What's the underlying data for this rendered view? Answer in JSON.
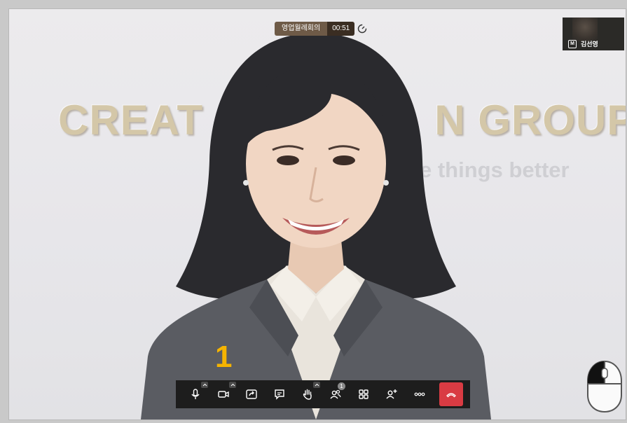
{
  "meeting": {
    "name": "영업월례회의",
    "time": "00:51"
  },
  "background_slide": {
    "title_left": "CREAT",
    "title_right": "N GROUP",
    "subtitle": "e things better"
  },
  "self_view": {
    "badge": "M",
    "name": "김선영"
  },
  "annotation": {
    "step_number": "1"
  },
  "toolbar": {
    "buttons": [
      {
        "name": "microphone-button",
        "icon": "microphone-icon",
        "has_caret": true
      },
      {
        "name": "camera-button",
        "icon": "video-camera-icon",
        "has_caret": true
      },
      {
        "name": "screen-share-button",
        "icon": "share-screen-icon",
        "has_caret": false
      },
      {
        "name": "chat-button",
        "icon": "chat-icon",
        "has_caret": false
      },
      {
        "name": "raise-hand-button",
        "icon": "hand-icon",
        "has_caret": true
      },
      {
        "name": "participants-button",
        "icon": "people-icon",
        "badge": "1"
      },
      {
        "name": "layout-button",
        "icon": "grid-icon",
        "has_caret": false
      },
      {
        "name": "invite-button",
        "icon": "add-person-icon",
        "has_caret": false
      },
      {
        "name": "more-button",
        "icon": "more-dots-icon",
        "has_caret": false
      }
    ],
    "end_call": {
      "icon": "hang-up-icon",
      "color": "#d93b43"
    }
  },
  "colors": {
    "toolbar_bg": "#1d1d1d",
    "pill_name_bg": "#6e5a47",
    "pill_time_bg": "#3a2d22",
    "annotation": "#f5b400"
  }
}
